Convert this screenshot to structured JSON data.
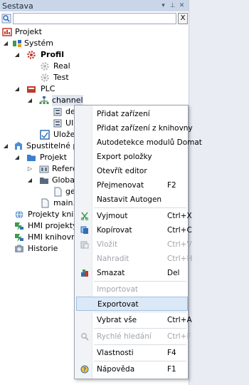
{
  "panel": {
    "title": "Sestava",
    "buttons": [
      "▾",
      "⊥",
      "✕"
    ]
  },
  "search": {
    "value": "",
    "placeholder": "",
    "clear_label": "X"
  },
  "tree": {
    "projekt": "Projekt",
    "system": "Systém",
    "profil": "Profil",
    "real": "Real",
    "test": "Test",
    "plc": "PLC",
    "channel": "channel",
    "dev": "dev",
    "uid": "UID",
    "ulozene": "Uložen",
    "spustitelne": "Spustitelné proj",
    "projekt2": "Projekt",
    "referen": "Referer",
    "globals": "Globals",
    "ger": "ger",
    "main": "main.P",
    "projekty_knihovny": "Projekty knihov",
    "hmi_projekty": "HMI projekty",
    "hmi_knihovna": "HMI knihovna",
    "historie": "Historie"
  },
  "menu": {
    "pridat_zarizeni": "Přidat zařízení",
    "pridat_z_knihovny": "Přidat zařízení z knihovny",
    "autodetekce": "Autodetekce modulů Domat",
    "export_polozky": "Export položky",
    "otevrit_editor": "Otevřít editor",
    "prejmenovat": "Přejmenovat",
    "prejmenovat_sc": "F2",
    "nastavit_autogen": "Nastavit Autogen",
    "vyjmout": "Vyjmout",
    "vyjmout_sc": "Ctrl+X",
    "kopirovat": "Kopírovat",
    "kopirovat_sc": "Ctrl+C",
    "vlozit": "Vložit",
    "vlozit_sc": "Ctrl+V",
    "nahradit": "Nahradit",
    "nahradit_sc": "Ctrl+H",
    "smazat": "Smazat",
    "smazat_sc": "Del",
    "importovat": "Importovat",
    "exportovat": "Exportovat",
    "vybrat_vse": "Vybrat vše",
    "vybrat_vse_sc": "Ctrl+A",
    "rychle_hledani": "Rychlé hledání",
    "rychle_hledani_sc": "Ctrl+F",
    "vlastnosti": "Vlastnosti",
    "vlastnosti_sc": "F4",
    "napoveda": "Nápověda",
    "napoveda_sc": "F1"
  },
  "colors": {
    "title_bar": "#c9d6e8",
    "menu_highlight": "#dbe8f7",
    "tree_selection": "#dfe6f0"
  }
}
